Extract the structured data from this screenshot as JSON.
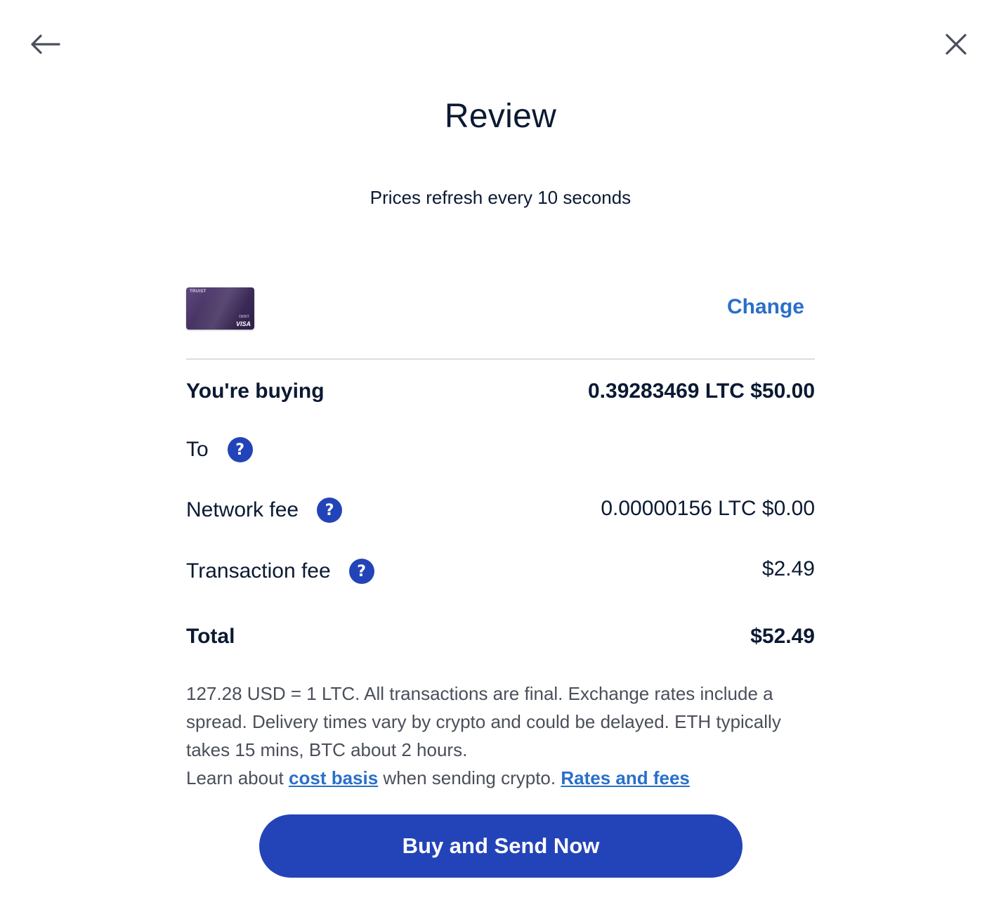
{
  "header": {
    "back_icon": "arrow-left-icon",
    "close_icon": "close-icon",
    "title": "Review",
    "subtitle": "Prices refresh every 10 seconds"
  },
  "payment_method": {
    "card_icon": "debit-card-icon",
    "card_brand_text": "TRUIST",
    "card_type_text": "DEBIT",
    "card_network_text": "VISA",
    "change_label": "Change"
  },
  "summary": {
    "buying": {
      "label": "You're buying",
      "value": "0.39283469 LTC $50.00"
    },
    "to": {
      "label": "To",
      "help_icon": "question-icon",
      "help_glyph": "?"
    },
    "network_fee": {
      "label": "Network fee",
      "help_glyph": "?",
      "value": "0.00000156 LTC $0.00"
    },
    "transaction_fee": {
      "label": "Transaction fee",
      "help_glyph": "?",
      "value": "$2.49"
    },
    "total": {
      "label": "Total",
      "value": "$52.49"
    }
  },
  "disclaimer": {
    "text": "127.28 USD = 1 LTC. All transactions are final. Exchange rates include a spread. Delivery times vary by crypto and could be delayed. ETH typically takes 15 mins, BTC about 2 hours.",
    "learn_prefix": "Learn about ",
    "cost_basis_link": "cost basis",
    "learn_suffix": " when sending crypto. ",
    "rates_link": "Rates and fees"
  },
  "actions": {
    "primary_label": "Buy and Send Now"
  },
  "colors": {
    "primary": "#2344b8",
    "link": "#2a6fc9",
    "text": "#0b1a33",
    "muted": "#4a4f5a"
  }
}
